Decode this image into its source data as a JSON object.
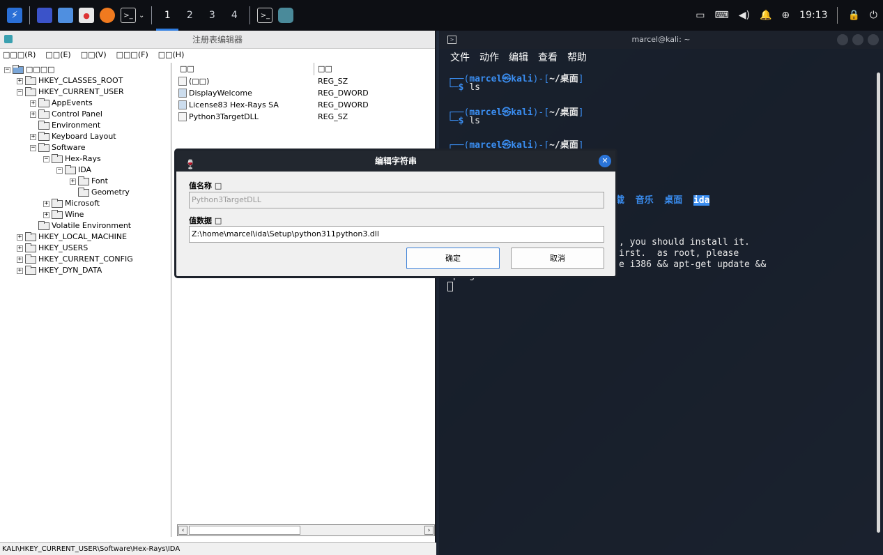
{
  "panel": {
    "workspaces": [
      "1",
      "2",
      "3",
      "4"
    ],
    "active_workspace": "1",
    "clock": "19:13"
  },
  "regedit": {
    "title": "注册表编辑器",
    "menu": [
      "□□□(R)",
      "□□(E)",
      "□□(V)",
      "□□□(F)",
      "□□(H)"
    ],
    "tree": {
      "root": "□□□□",
      "hkcr": "HKEY_CLASSES_ROOT",
      "hkcu": "HKEY_CURRENT_USER",
      "appevents": "AppEvents",
      "control_panel": "Control Panel",
      "environment": "Environment",
      "keyboard_layout": "Keyboard Layout",
      "software": "Software",
      "hexrays": "Hex-Rays",
      "ida": "IDA",
      "font": "Font",
      "geometry": "Geometry",
      "microsoft": "Microsoft",
      "wine": "Wine",
      "volatile": "Volatile Environment",
      "hklm": "HKEY_LOCAL_MACHINE",
      "hku": "HKEY_USERS",
      "hkcc": "HKEY_CURRENT_CONFIG",
      "hkdd": "HKEY_DYN_DATA"
    },
    "list": {
      "col_name": "□□",
      "col_type": "□□",
      "rows": [
        {
          "name": "(□□)",
          "type": "REG_SZ"
        },
        {
          "name": "DisplayWelcome",
          "type": "REG_DWORD"
        },
        {
          "name": "License83 Hex-Rays SA",
          "type": "REG_DWORD"
        },
        {
          "name": "Python3TargetDLL",
          "type": "REG_SZ"
        }
      ]
    },
    "status": "KALI\\HKEY_CURRENT_USER\\Software\\Hex-Rays\\IDA"
  },
  "dialog": {
    "title": "编辑字符串",
    "name_label": "值名称 □",
    "name_value": "Python3TargetDLL",
    "data_label": "值数据 □",
    "data_value": "Z:\\home\\marcel\\ida\\Setup\\python311python3.dll",
    "ok": "确定",
    "cancel": "取消"
  },
  "terminal": {
    "title": "marcel@kali: ~",
    "menu": [
      "文件",
      "动作",
      "编辑",
      "查看",
      "帮助"
    ],
    "prompt_user": "marcel㉿kali",
    "prompt_dir": "~/桌面",
    "cmd": "ls",
    "dirs": "下载  音乐  桌面  ",
    "dir_ida": "ida",
    "msg1": ", you should install it.",
    "msg2": "irst.  as root, please",
    "msg3": "e i386 && apt-get update &&",
    "msg4": "apt-get install wine32:i386"
  }
}
